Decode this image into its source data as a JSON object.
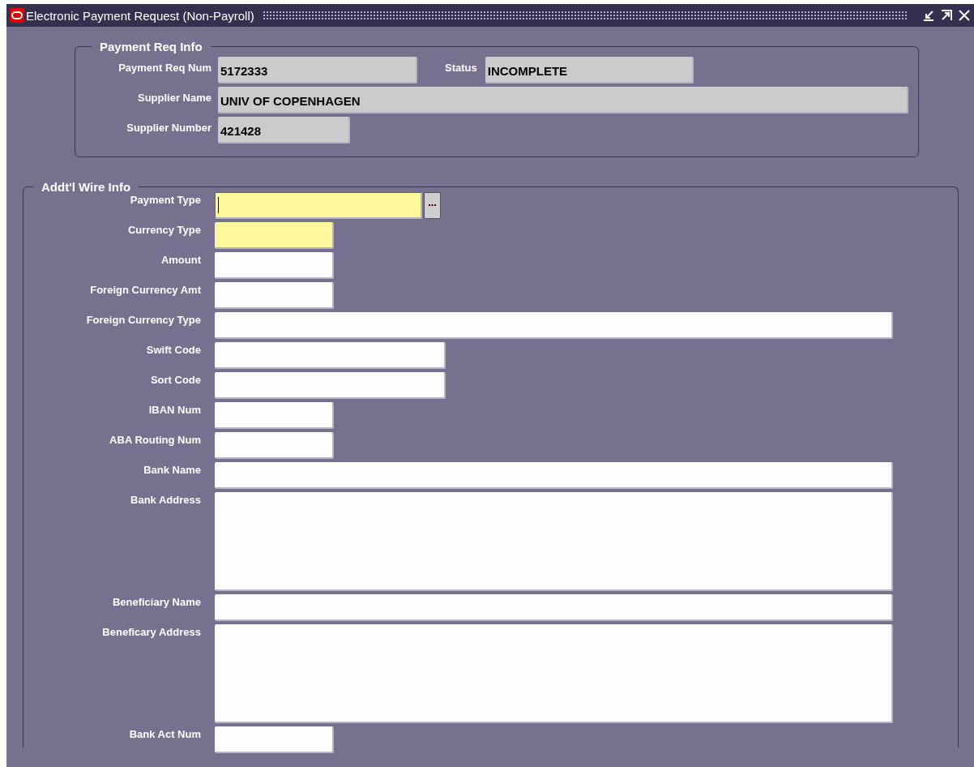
{
  "window": {
    "title": "Electronic Payment Request (Non-Payroll)"
  },
  "payment_req_info": {
    "title": "Payment Req Info",
    "rows": [
      {
        "fields": [
          {
            "label": "Payment Req Num",
            "value": "5172333"
          },
          {
            "label": "Status",
            "value": "INCOMPLETE"
          }
        ]
      },
      {
        "fields": [
          {
            "label": "Supplier Name",
            "value": "UNIV OF COPENHAGEN"
          }
        ]
      },
      {
        "fields": [
          {
            "label": "Supplier Number",
            "value": "421428"
          }
        ]
      }
    ]
  },
  "wire_info": {
    "title": "Addt'l Wire Info",
    "fields": [
      {
        "label": "Payment Type",
        "kind": "text",
        "required": true,
        "focused": true,
        "has_lov": true
      },
      {
        "label": "Currency Type",
        "kind": "text",
        "required": true,
        "focused": false,
        "has_lov": false
      },
      {
        "label": "Amount",
        "kind": "text",
        "required": false,
        "focused": false,
        "has_lov": false
      },
      {
        "label": "Foreign Currency Amt",
        "kind": "text",
        "required": false,
        "focused": false,
        "has_lov": false
      },
      {
        "label": "Foreign Currency Type",
        "kind": "text",
        "required": false,
        "focused": false,
        "has_lov": false
      },
      {
        "label": "Swift Code",
        "kind": "text",
        "required": false,
        "focused": false,
        "has_lov": false
      },
      {
        "label": "Sort Code",
        "kind": "text",
        "required": false,
        "focused": false,
        "has_lov": false
      },
      {
        "label": "IBAN Num",
        "kind": "text",
        "required": false,
        "focused": false,
        "has_lov": false
      },
      {
        "label": "ABA Routing Num",
        "kind": "text",
        "required": false,
        "focused": false,
        "has_lov": false
      },
      {
        "label": "Bank Name",
        "kind": "text",
        "required": false,
        "focused": false,
        "has_lov": false
      },
      {
        "label": "Bank Address",
        "kind": "multiline",
        "required": false,
        "focused": false,
        "has_lov": false
      },
      {
        "label": "Beneficiary Name",
        "kind": "text",
        "required": false,
        "focused": false,
        "has_lov": false
      },
      {
        "label": "Beneficary Address",
        "kind": "multiline",
        "required": false,
        "focused": false,
        "has_lov": false
      },
      {
        "label": "Bank Act Num",
        "kind": "text",
        "required": false,
        "focused": false,
        "has_lov": false
      }
    ]
  }
}
